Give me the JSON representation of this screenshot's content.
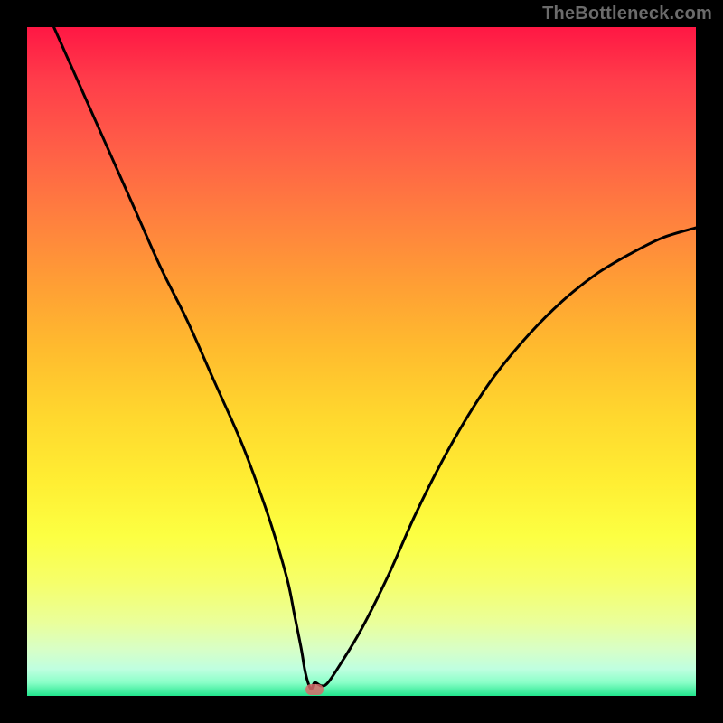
{
  "watermark": "TheBottleneck.com",
  "colors": {
    "frame": "#000000",
    "curve": "#000000",
    "marker": "#d86a6a",
    "gradient_top": "#ff1744",
    "gradient_bottom": "#21e58d"
  },
  "chart_data": {
    "type": "line",
    "title": "",
    "xlabel": "",
    "ylabel": "",
    "xlim": [
      0,
      100
    ],
    "ylim": [
      0,
      100
    ],
    "grid": false,
    "series": [
      {
        "name": "bottleneck-curve",
        "x": [
          4,
          8,
          12,
          16,
          20,
          24,
          28,
          32,
          35,
          37,
          39,
          40,
          41,
          41.5,
          42,
          42.5,
          43,
          44,
          45,
          47,
          50,
          54,
          58,
          62,
          66,
          70,
          75,
          80,
          85,
          90,
          95,
          100
        ],
        "y": [
          100,
          91,
          82,
          73,
          64,
          56,
          47,
          38,
          30,
          24,
          17,
          12,
          7,
          4,
          2,
          1,
          2,
          1.5,
          2,
          5,
          10,
          18,
          27,
          35,
          42,
          48,
          54,
          59,
          63,
          66,
          68.5,
          70
        ]
      }
    ],
    "marker": {
      "x": 43,
      "y": 1
    },
    "annotations": []
  }
}
